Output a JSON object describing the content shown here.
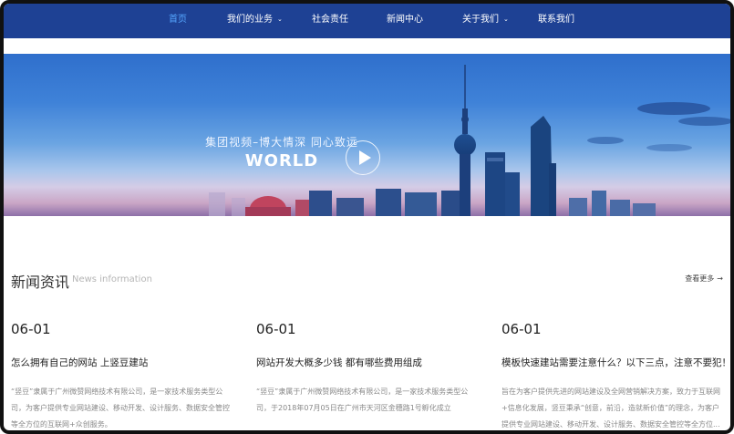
{
  "nav": {
    "items": [
      {
        "label": "首页",
        "active": true,
        "dropdown": false
      },
      {
        "label": "我们的业务",
        "active": false,
        "dropdown": true
      },
      {
        "label": "社会责任",
        "active": false,
        "dropdown": false
      },
      {
        "label": "新闻中心",
        "active": false,
        "dropdown": false
      },
      {
        "label": "关于我们",
        "active": false,
        "dropdown": true
      },
      {
        "label": "联系我们",
        "active": false,
        "dropdown": false
      }
    ]
  },
  "banner": {
    "subtitle": "集团视频–博大情深 同心致远",
    "title": "WORLD",
    "play_icon": "play-icon"
  },
  "news": {
    "title": "新闻资讯",
    "subtitle": "News information",
    "more_label": "查看更多",
    "items": [
      {
        "date": "06-01",
        "headline": "怎么拥有自己的网站 上竖豆建站",
        "desc": "“竖豆”隶属于广州微赞网络技术有限公司，是一家技术服务类型公司，为客户提供专业网站建设、移动开发、设计服务、数据安全管控等全方位的互联网+众创服务。"
      },
      {
        "date": "06-01",
        "headline": "网站开发大概多少钱 都有哪些费用组成",
        "desc": "“竖豆”隶属于广州微赞网络技术有限公司，是一家技术服务类型公司，于2018年07月05日在广州市天河区金穗路1号孵化成立"
      },
      {
        "date": "06-01",
        "headline": "模板快速建站需要注意什么？以下三点，注意不要犯！",
        "desc": "旨在为客户提供先进的网站建设及全网营销解决方案，致力于互联网+信息化发展，竖豆秉承“创意，前沿，造就新价值”的理念，为客户提供专业网站建设、移动开发、设计服务、数据安全管控等全方位..."
      }
    ]
  },
  "colors": {
    "nav_bg": "#1e4194",
    "nav_active": "#55a6ff"
  }
}
